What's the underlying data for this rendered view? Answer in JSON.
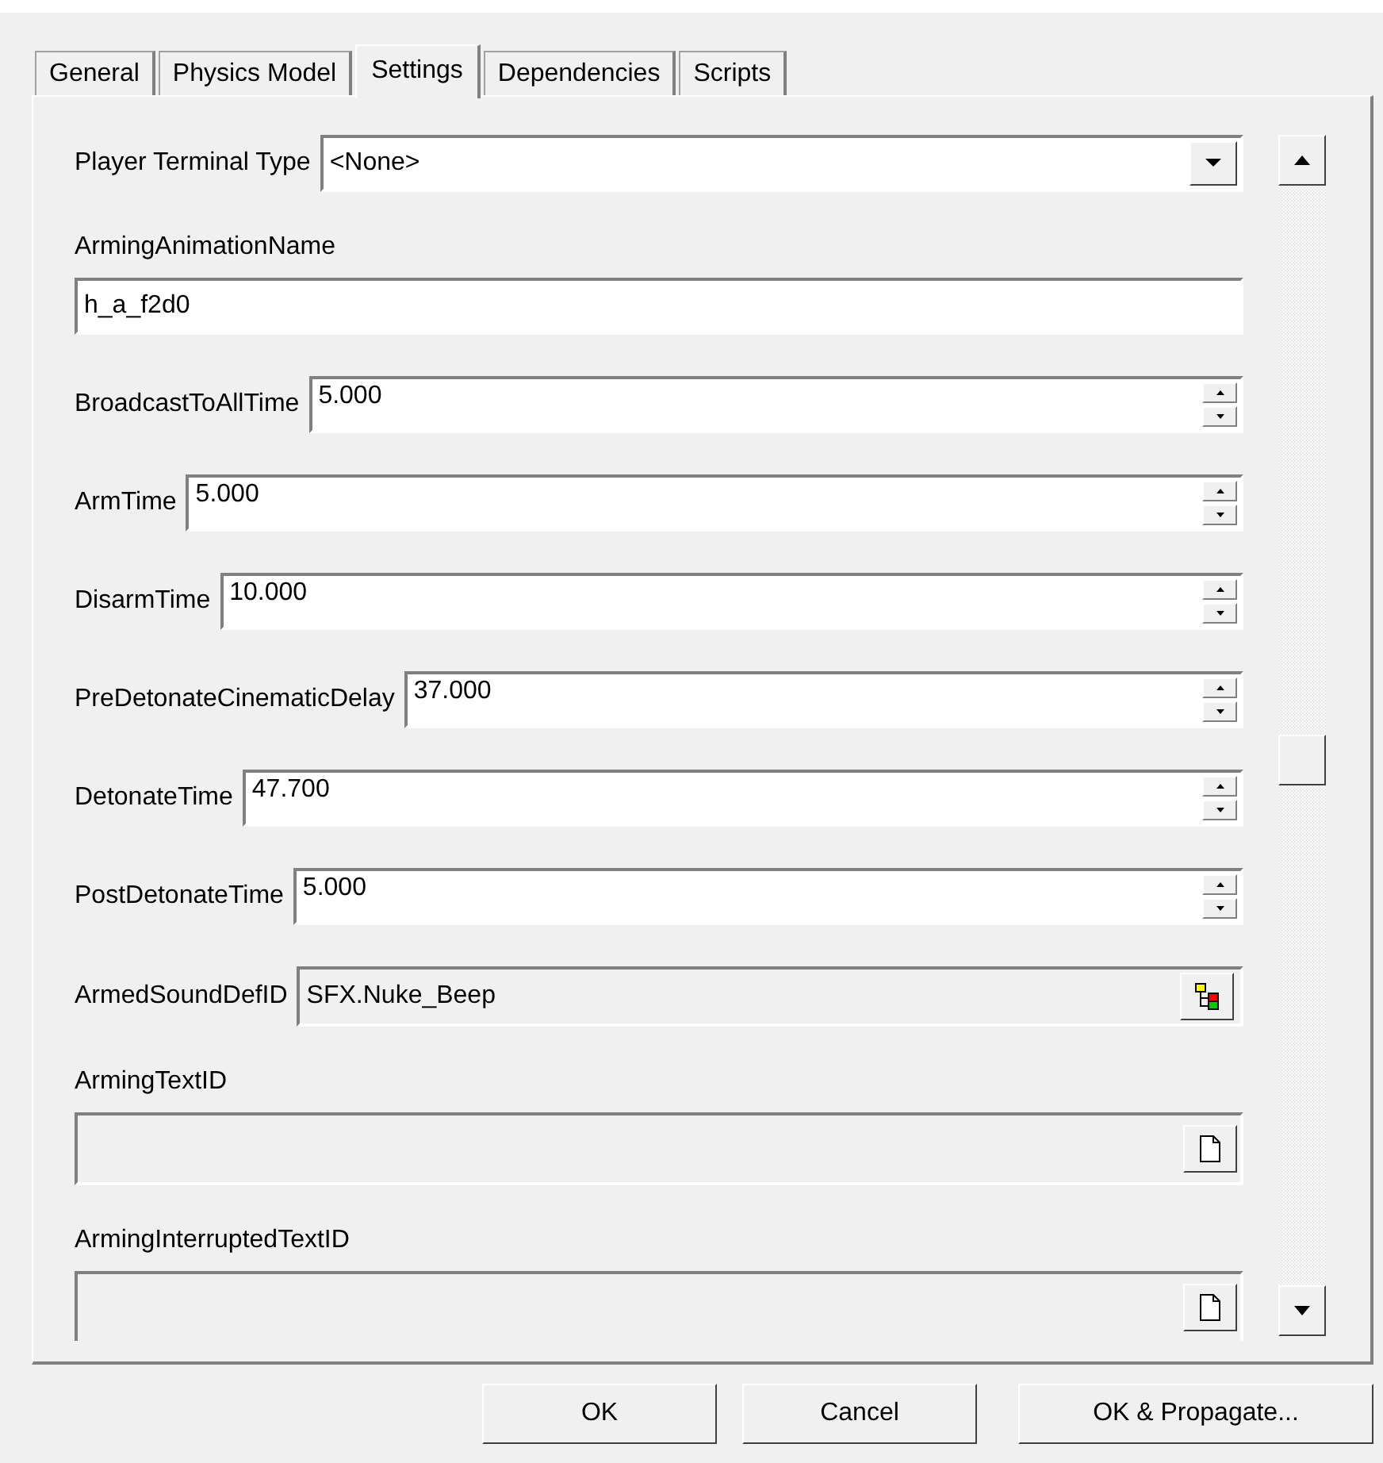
{
  "tabs": [
    {
      "label": "General",
      "selected": false
    },
    {
      "label": "Physics Model",
      "selected": false
    },
    {
      "label": "Settings",
      "selected": true
    },
    {
      "label": "Dependencies",
      "selected": false
    },
    {
      "label": "Scripts",
      "selected": false
    }
  ],
  "fields": [
    {
      "kind": "dropdown",
      "label": "Player Terminal Type",
      "value": "<None>"
    },
    {
      "kind": "text",
      "label": "ArmingAnimationName",
      "value": "h_a_f2d0"
    },
    {
      "kind": "spin",
      "label": "BroadcastToAllTime",
      "value": "5.000"
    },
    {
      "kind": "spin",
      "label": "ArmTime",
      "value": "5.000"
    },
    {
      "kind": "spin",
      "label": "DisarmTime",
      "value": "10.000"
    },
    {
      "kind": "spin",
      "label": "PreDetonateCinematicDelay",
      "value": "37.000"
    },
    {
      "kind": "spin",
      "label": "DetonateTime",
      "value": "47.700"
    },
    {
      "kind": "spin",
      "label": "PostDetonateTime",
      "value": "5.000"
    },
    {
      "kind": "lookup",
      "label": "ArmedSoundDefID",
      "value": "SFX.Nuke_Beep"
    },
    {
      "kind": "document",
      "label": "ArmingTextID"
    },
    {
      "kind": "document",
      "label": "ArmingInterruptedTextID"
    }
  ],
  "buttons": [
    "OK",
    "Cancel",
    "OK & Propagate..."
  ]
}
